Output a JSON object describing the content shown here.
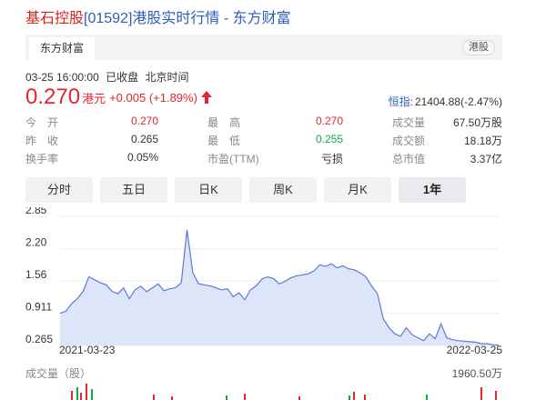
{
  "page": {
    "title_stock": "基石控股",
    "title_rest": "[01592]港股实时行情 - 东方财富"
  },
  "header": {
    "brand_tab": "东方财富",
    "market_badge": "港股"
  },
  "quote": {
    "datetime": "03-25 16:00:00",
    "status": "已收盘",
    "timezone": "北京时间",
    "price": "0.270",
    "currency": "港元",
    "change": "+0.005 (+1.89%)",
    "index_name": "恒指:",
    "index_value": "21404.88(-2.47%)"
  },
  "stats": [
    {
      "l1": "今　开",
      "v1": "0.270",
      "l2": "最　高",
      "v2": "0.270",
      "l3": "成交量",
      "v3": "67.50万股"
    },
    {
      "l1": "昨　收",
      "v1": "0.265",
      "l2": "最　低",
      "v2": "0.255",
      "l3": "成交额",
      "v3": "18.18万"
    },
    {
      "l1": "换手率",
      "v1": "0.05%",
      "l2": "市盈(TTM)",
      "v2": "亏损",
      "l3": "总市值",
      "v3": "3.37亿"
    }
  ],
  "tabs": [
    "分时",
    "五日",
    "日K",
    "周K",
    "月K",
    "1年"
  ],
  "active_tab": "1年",
  "colors": {
    "up": "#e4262d",
    "down": "#16a34a",
    "line": "#5b7bd5",
    "fill": "#dde5f8"
  },
  "chart_data": {
    "type": "area",
    "x_start": "2021-03-23",
    "x_end": "2022-03-25",
    "y_ticks": [
      "2.85",
      "2.20",
      "1.56",
      "0.911",
      "0.265"
    ],
    "ylim": [
      0.265,
      2.85
    ],
    "values": [
      0.91,
      0.95,
      1.1,
      1.2,
      1.35,
      1.64,
      1.58,
      1.52,
      1.48,
      1.35,
      1.3,
      1.42,
      1.2,
      1.38,
      1.45,
      1.34,
      1.42,
      1.5,
      1.36,
      1.4,
      1.42,
      1.52,
      2.58,
      1.72,
      1.5,
      1.48,
      1.46,
      1.42,
      1.38,
      1.4,
      1.24,
      1.32,
      1.18,
      1.38,
      1.46,
      1.6,
      1.64,
      1.6,
      1.5,
      1.55,
      1.62,
      1.66,
      1.68,
      1.7,
      1.76,
      1.88,
      1.85,
      1.9,
      1.82,
      1.86,
      1.8,
      1.78,
      1.72,
      1.64,
      1.45,
      1.3,
      0.8,
      0.62,
      0.5,
      0.45,
      0.62,
      0.48,
      0.42,
      0.36,
      0.5,
      0.4,
      0.7,
      0.42,
      0.38,
      0.36,
      0.35,
      0.34,
      0.33,
      0.3,
      0.3,
      0.28,
      0.27
    ]
  },
  "volume": {
    "label": "成交量（股）",
    "max": "1960.50万"
  }
}
